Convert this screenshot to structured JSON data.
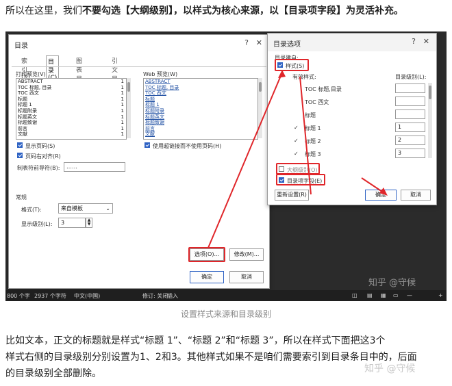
{
  "intro": {
    "lead": "所以在这里，我们",
    "bold": "不要勾选【大纲级别】，以样式为核心来源，以【目录项字段】为灵活补充。"
  },
  "toc_dialog": {
    "title": "目录",
    "tabs": [
      "索引(X)",
      "目录(C)",
      "图表目录(F)",
      "引文目录(A)"
    ],
    "print_preview_label": "打印预览(V)",
    "print_preview_rows": [
      {
        "text": "ABSTRACT",
        "num": "1"
      },
      {
        "text": "TOC 标题, 目录",
        "num": "1"
      },
      {
        "text": "TOC 西文",
        "num": "1"
      },
      {
        "text": "标题",
        "num": "1"
      },
      {
        "text": "标题 1",
        "num": "1"
      },
      {
        "text": "标题附录",
        "num": "1"
      },
      {
        "text": "标题英文",
        "num": "1"
      },
      {
        "text": "标题致谢",
        "num": "1"
      },
      {
        "text": "前言",
        "num": "1"
      },
      {
        "text": "文献",
        "num": "1"
      }
    ],
    "web_preview_label": "Web 预览(W)",
    "web_preview_rows": [
      "ABSTRACT",
      "TOC 标题, 目录",
      "TOC 西文",
      "标题",
      "标题 1",
      "标题附录",
      "标题英文",
      "标题致谢",
      "前言",
      "文献"
    ],
    "show_page_numbers": "显示页码(S)",
    "right_align": "页码右对齐(R)",
    "tab_leader_label": "制表符前导符(B):",
    "tab_leader_value": "……",
    "use_hyperlinks": "使用超链接而不使用页码(H)",
    "general_label": "常规",
    "formats_label": "格式(T):",
    "formats_value": "来自模板",
    "show_levels_label": "显示级别(L):",
    "show_levels_value": "3",
    "options_btn": "选项(O)...",
    "modify_btn": "修改(M)...",
    "ok_btn": "确定",
    "cancel_btn": "取消"
  },
  "options_dialog": {
    "title": "目录选项",
    "build_from": "目录建自:",
    "styles_label": "样式(S)",
    "available_styles": "有效样式:",
    "toc_level": "目录级别(L):",
    "rows": [
      {
        "name": "TOC 标题,目录",
        "level": "",
        "checked": false
      },
      {
        "name": "TOC 西文",
        "level": "",
        "checked": false
      },
      {
        "name": "标题",
        "level": "",
        "checked": false
      },
      {
        "name": "标题 1",
        "level": "1",
        "checked": true
      },
      {
        "name": "标题 2",
        "level": "2",
        "checked": true
      },
      {
        "name": "标题 3",
        "level": "3",
        "checked": true
      }
    ],
    "outline_levels": "大纲级别(O)",
    "toc_entry_fields": "目录项字段(E)",
    "reset_btn": "重新设置(R)",
    "ok_btn": "确定",
    "cancel_btn": "取消"
  },
  "status_bar": {
    "pages": "800 个字",
    "words": "2937 个字符",
    "lang": "中文(中国)",
    "track": "修订: 关闭",
    "insert": "插入"
  },
  "watermark": "知乎 @守候",
  "caption": "设置样式来源和目录级别",
  "body_text": {
    "line1": "比如文本，正文的标题就是样式“标题 1”、“标题 2”和“标题 3”，所以在样式下面把这3个",
    "line2": "样式右侧的目录级别分别设置为1、2和3。其他样式如果不是咱们需要索引到目录条目中的，后面",
    "line3": "的目录级别全部删除。"
  }
}
